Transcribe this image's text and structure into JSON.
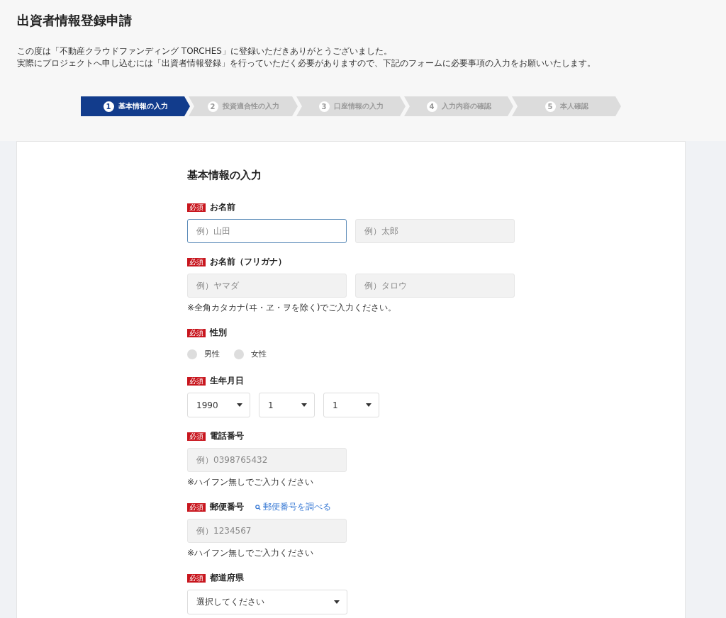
{
  "title": "出資者情報登録申請",
  "intro": [
    "この度は「不動産クラウドファンディング TORCHES」に登録いただきありがとうございました。",
    "実際にプロジェクトへ申し込むには「出資者情報登録」を行っていただく必要がありますので、下記のフォームに必要事項の入力をお願いいたします。"
  ],
  "steps": [
    {
      "number": "1",
      "label": "基本情報の入力",
      "selected": true
    },
    {
      "number": "2",
      "label": "投資適合性の入力",
      "selected": false
    },
    {
      "number": "3",
      "label": "口座情報の入力",
      "selected": false
    },
    {
      "number": "4",
      "label": "入力内容の確認",
      "selected": false
    },
    {
      "number": "5",
      "label": "本人確認",
      "selected": false
    }
  ],
  "section_title": "基本情報の入力",
  "fields": [
    {
      "kind": "inputs",
      "badge": "必須",
      "label": "お名前",
      "inputs": [
        {
          "placeholder": "例）山田",
          "focused": true
        },
        {
          "placeholder": "例）太郎",
          "focused": false
        }
      ]
    },
    {
      "kind": "inputs",
      "badge": "必須",
      "label": "お名前（フリガナ）",
      "inputs": [
        {
          "placeholder": "例）ヤマダ",
          "focused": false
        },
        {
          "placeholder": "例）タロウ",
          "focused": false
        }
      ],
      "note": "※全角カタカナ(ヰ・ヱ・ヲを除く)でご入力ください。"
    },
    {
      "kind": "radio",
      "badge": "必須",
      "label": "性別",
      "options": [
        {
          "label": "男性",
          "selected": false
        },
        {
          "label": "女性",
          "selected": false
        }
      ]
    },
    {
      "kind": "selects",
      "badge": "必須",
      "label": "生年月日",
      "selects": [
        {
          "value": "1990"
        },
        {
          "value": "1"
        },
        {
          "value": "1"
        }
      ]
    },
    {
      "kind": "inputs",
      "badge": "必須",
      "label": "電話番号",
      "inputs": [
        {
          "placeholder": "例）0398765432",
          "focused": false
        }
      ],
      "note": "※ハイフン無しでご入力ください"
    },
    {
      "kind": "inputs",
      "badge": "必須",
      "label": "郵便番号",
      "link": "郵便番号を調べる",
      "inputs": [
        {
          "placeholder": "例）1234567",
          "focused": false
        }
      ],
      "note": "※ハイフン無しでご入力ください"
    },
    {
      "kind": "selects",
      "badge": "必須",
      "label": "都道府県",
      "selects": [
        {
          "value": "選択してください"
        }
      ]
    }
  ]
}
